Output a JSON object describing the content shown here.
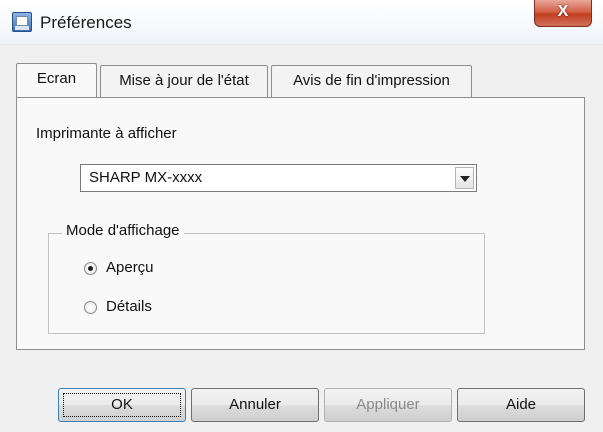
{
  "window": {
    "title": "Préférences",
    "close_label": "X",
    "app_icon": "printer-window-icon"
  },
  "tabs": [
    {
      "label": "Ecran",
      "active": true
    },
    {
      "label": "Mise à jour de l'état",
      "active": false
    },
    {
      "label": "Avis de fin d'impression",
      "active": false
    }
  ],
  "printer": {
    "label": "Imprimante à afficher",
    "selected_value": "SHARP MX-xxxx"
  },
  "display_mode": {
    "group_label": "Mode d'affichage",
    "options": [
      {
        "label": "Aperçu",
        "checked": true
      },
      {
        "label": "Détails",
        "checked": false
      }
    ]
  },
  "buttons": {
    "ok": "OK",
    "cancel": "Annuler",
    "apply": "Appliquer",
    "help": "Aide"
  }
}
